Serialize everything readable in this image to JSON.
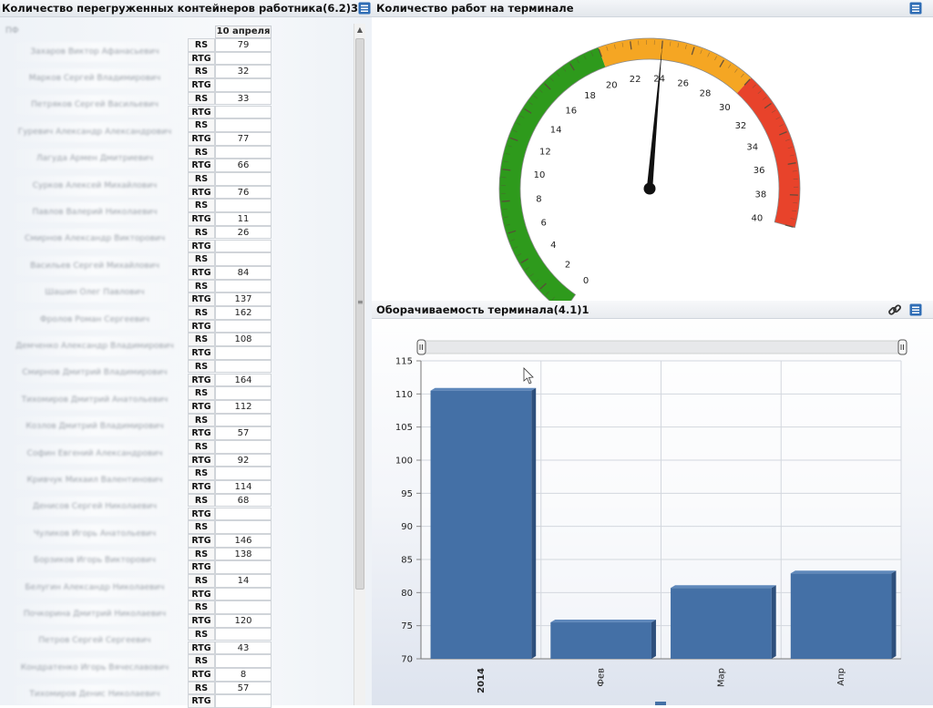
{
  "left_panel": {
    "title": "Количество перегруженных контейнеров работника(6.2)3",
    "corner_label": "ПФ",
    "date_header": "10 апреля",
    "rs_label": "RS",
    "rtg_label": "RTG",
    "workers": [
      {
        "name": "Захаров Виктор Афанасьевич",
        "rs": "79",
        "rtg": ""
      },
      {
        "name": "Марков Сергей Владимирович",
        "rs": "32",
        "rtg": ""
      },
      {
        "name": "Петряков Сергей Васильевич",
        "rs": "33",
        "rtg": ""
      },
      {
        "name": "Гуревич Александр Александрович",
        "rs": "",
        "rtg": "77"
      },
      {
        "name": "Лагуда Армен Дмитриевич",
        "rs": "",
        "rtg": "66"
      },
      {
        "name": "Сурков Алексей Михайлович",
        "rs": "",
        "rtg": "76"
      },
      {
        "name": "Павлов Валерий Николаевич",
        "rs": "",
        "rtg": "11"
      },
      {
        "name": "Смирнов Александр Викторович",
        "rs": "26",
        "rtg": ""
      },
      {
        "name": "Васильев Сергей Михайлович",
        "rs": "",
        "rtg": "84"
      },
      {
        "name": "Шашин Олег Павлович",
        "rs": "",
        "rtg": "137"
      },
      {
        "name": "Фролов Роман Сергеевич",
        "rs": "162",
        "rtg": ""
      },
      {
        "name": "Демченко Александр Владимирович",
        "rs": "108",
        "rtg": ""
      },
      {
        "name": "Смирнов Дмитрий Владимирович",
        "rs": "",
        "rtg": "164"
      },
      {
        "name": "Тихомиров Дмитрий Анатольевич",
        "rs": "",
        "rtg": "112"
      },
      {
        "name": "Козлов Дмитрий Владимирович",
        "rs": "",
        "rtg": "57"
      },
      {
        "name": "Софин Евгений Александрович",
        "rs": "",
        "rtg": "92"
      },
      {
        "name": "Кривчук Михаил Валентинович",
        "rs": "",
        "rtg": "114"
      },
      {
        "name": "Денисов Сергей Николаевич",
        "rs": "68",
        "rtg": ""
      },
      {
        "name": "Чуликов Игорь Анатольевич",
        "rs": "",
        "rtg": "146"
      },
      {
        "name": "Борзиков Игорь Викторович",
        "rs": "138",
        "rtg": ""
      },
      {
        "name": "Белугин Александр Николаевич",
        "rs": "14",
        "rtg": ""
      },
      {
        "name": "Почкорина Дмитрий Николаевич",
        "rs": "",
        "rtg": "120"
      },
      {
        "name": "Петров Сергей Сергеевич",
        "rs": "",
        "rtg": "43"
      },
      {
        "name": "Кондратенко Игорь Вячеславович",
        "rs": "",
        "rtg": "8"
      },
      {
        "name": "Тихомиров Денис Николаевич",
        "rs": "57",
        "rtg": ""
      }
    ]
  },
  "gauge_panel": {
    "title": "Количество работ на терминале",
    "min": 0,
    "max": 40,
    "value": 24,
    "tick_labels": [
      "0",
      "2",
      "4",
      "6",
      "8",
      "10",
      "12",
      "14",
      "16",
      "18",
      "20",
      "22",
      "24",
      "26",
      "28",
      "30",
      "32",
      "34",
      "36",
      "38",
      "40"
    ],
    "bands": [
      {
        "from": 0,
        "to": 20,
        "color": "#2e9a1c"
      },
      {
        "from": 20,
        "to": 30,
        "color": "#f5a623"
      },
      {
        "from": 30,
        "to": 40,
        "color": "#e8432b"
      }
    ]
  },
  "bar_panel": {
    "title": "Оборачиваемость терминала(4.1)1"
  },
  "chart_data": {
    "type": "bar",
    "categories": [
      "2014",
      "Фев",
      "Мар",
      "Апр"
    ],
    "values": [
      110.5,
      75.5,
      80.7,
      82.9
    ],
    "ylim": [
      70,
      115
    ],
    "yticks": [
      "70",
      "75",
      "80",
      "85",
      "90",
      "95",
      "100",
      "105",
      "110",
      "115"
    ],
    "bar_color": "#4470a6",
    "grid": true,
    "title": "",
    "xlabel": "",
    "ylabel": ""
  }
}
